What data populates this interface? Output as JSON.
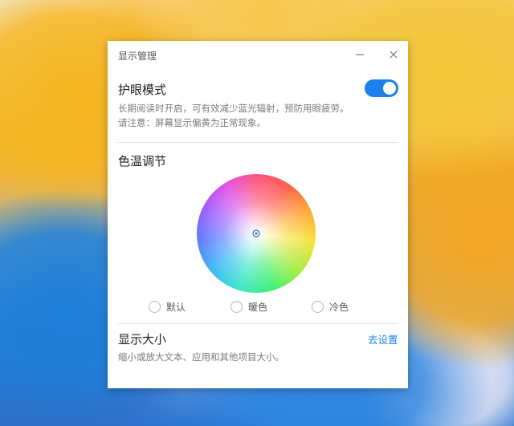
{
  "window": {
    "title": "显示管理",
    "minimize_icon": "minimize-icon",
    "close_icon": "close-icon"
  },
  "eye_care": {
    "heading": "护眼模式",
    "enabled": true,
    "desc_line1": "长期阅读时开启，可有效减少蓝光辐射，预防用眼疲劳。",
    "desc_line2": "请注意：屏幕显示偏黄为正常现象。",
    "accent_color": "#1a82e8"
  },
  "color_temp": {
    "heading": "色温调节",
    "wheel_center_icon": "target-dot-icon",
    "options": [
      {
        "label": "默认",
        "selected": false
      },
      {
        "label": "暖色",
        "selected": false
      },
      {
        "label": "冷色",
        "selected": false
      }
    ]
  },
  "display_size": {
    "heading": "显示大小",
    "link_label": "去设置",
    "desc": "缩小或放大文本、应用和其他项目大小。"
  }
}
